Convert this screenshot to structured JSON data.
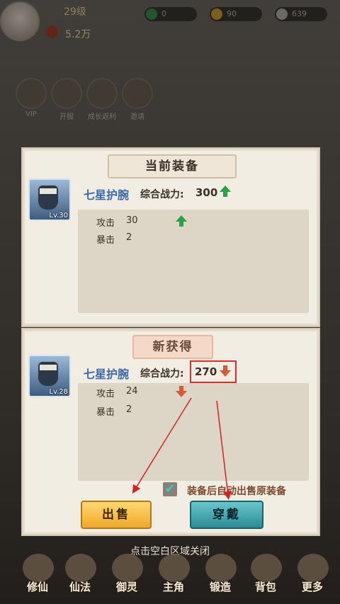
{
  "header": {
    "level": "29级",
    "power": "5.2万",
    "resources": [
      {
        "icon": "jade-coin-icon",
        "value": "0"
      },
      {
        "icon": "gold-ingot-icon",
        "value": "90"
      },
      {
        "icon": "silver-ingot-icon",
        "value": "639"
      }
    ]
  },
  "quick_actions": [
    {
      "label": "VIP",
      "icon": "vip-icon"
    },
    {
      "label": "开服",
      "icon": "gift-box-icon"
    },
    {
      "label": "成长返利",
      "icon": "chest-icon"
    },
    {
      "label": "邀请",
      "icon": "invite-icon"
    }
  ],
  "current": {
    "title": "当前装备",
    "name": "七星护腕",
    "level": "Lv.30",
    "power_label": "综合战力:",
    "power_value": "300",
    "stats": [
      {
        "name": "攻击",
        "value": "30"
      },
      {
        "name": "暴击",
        "value": "2"
      }
    ]
  },
  "new_item": {
    "title": "新获得",
    "name": "七星护腕",
    "level": "Lv.28",
    "power_label": "综合战力:",
    "power_value": "270",
    "stats": [
      {
        "name": "攻击",
        "value": "24"
      },
      {
        "name": "暴击",
        "value": "2"
      }
    ]
  },
  "auto_sell_label": "装备后自动出售原装备",
  "auto_sell_checked": true,
  "buttons": {
    "sell": "出售",
    "wear": "穿戴"
  },
  "close_hint": "点击空白区域关闭",
  "nav": [
    {
      "label": "修仙",
      "icon": "cultivate-icon"
    },
    {
      "label": "仙法",
      "icon": "spell-icon"
    },
    {
      "label": "御灵",
      "icon": "spirit-icon"
    },
    {
      "label": "主角",
      "icon": "hero-icon"
    },
    {
      "label": "锻造",
      "icon": "forge-icon"
    },
    {
      "label": "背包",
      "icon": "bag-icon"
    },
    {
      "label": "更多",
      "icon": "more-icon"
    }
  ],
  "colors": {
    "up": "#2da04a",
    "down": "#d8583a",
    "highlight": "#d03030"
  }
}
